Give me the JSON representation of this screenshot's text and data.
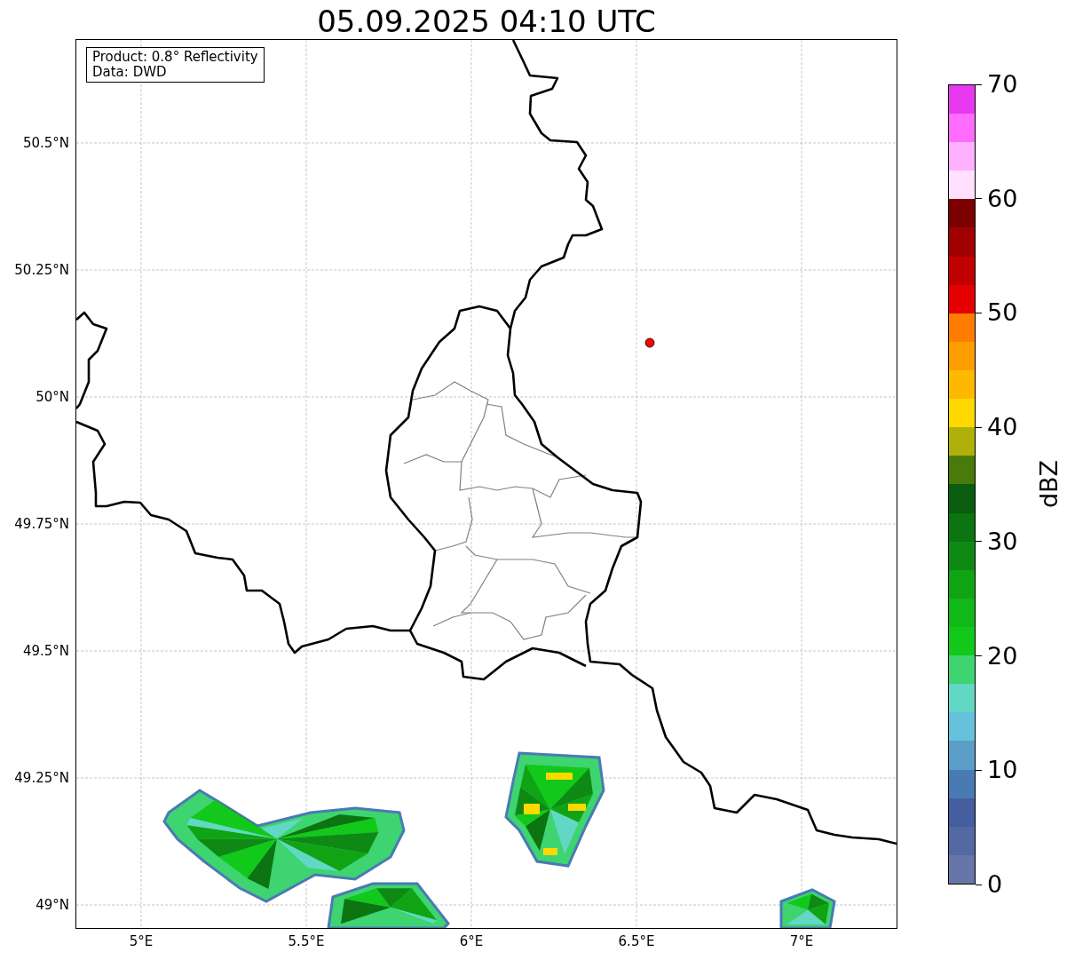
{
  "title": "05.09.2025 04:10 UTC",
  "info_box": [
    "Product: 0.8° Reflectivity",
    "Data: DWD"
  ],
  "map": {
    "x_ticks": [
      "5°E",
      "5.5°E",
      "6°E",
      "6.5°E",
      "7°E"
    ],
    "y_ticks": [
      "50.5°N",
      "50.25°N",
      "50°N",
      "49.75°N",
      "49.5°N",
      "49.25°N",
      "49°N"
    ],
    "radar_site": {
      "color": "#ff0000"
    }
  },
  "colorbar": {
    "label": "dBZ",
    "ticks": [
      "70",
      "60",
      "50",
      "40",
      "30",
      "20",
      "10",
      "0"
    ],
    "bands": [
      {
        "color": "#6676a8"
      },
      {
        "color": "#5468a2"
      },
      {
        "color": "#445ea0"
      },
      {
        "color": "#4a7ab4"
      },
      {
        "color": "#5a9ec8"
      },
      {
        "color": "#66c2dc"
      },
      {
        "color": "#62d8c4"
      },
      {
        "color": "#3ed470"
      },
      {
        "color": "#12c81a"
      },
      {
        "color": "#10b818"
      },
      {
        "color": "#10a414"
      },
      {
        "color": "#0e8a14"
      },
      {
        "color": "#0c7410"
      },
      {
        "color": "#0a5c0e"
      },
      {
        "color": "#4a7a0c"
      },
      {
        "color": "#b0b00a"
      },
      {
        "color": "#ffd800"
      },
      {
        "color": "#ffb800"
      },
      {
        "color": "#ff9c00"
      },
      {
        "color": "#ff7c00"
      },
      {
        "color": "#e40000"
      },
      {
        "color": "#c00000"
      },
      {
        "color": "#a00000"
      },
      {
        "color": "#7c0000"
      },
      {
        "color": "#ffe0ff"
      },
      {
        "color": "#ffb0ff"
      },
      {
        "color": "#ff6cff"
      },
      {
        "color": "#e838f0"
      }
    ]
  }
}
